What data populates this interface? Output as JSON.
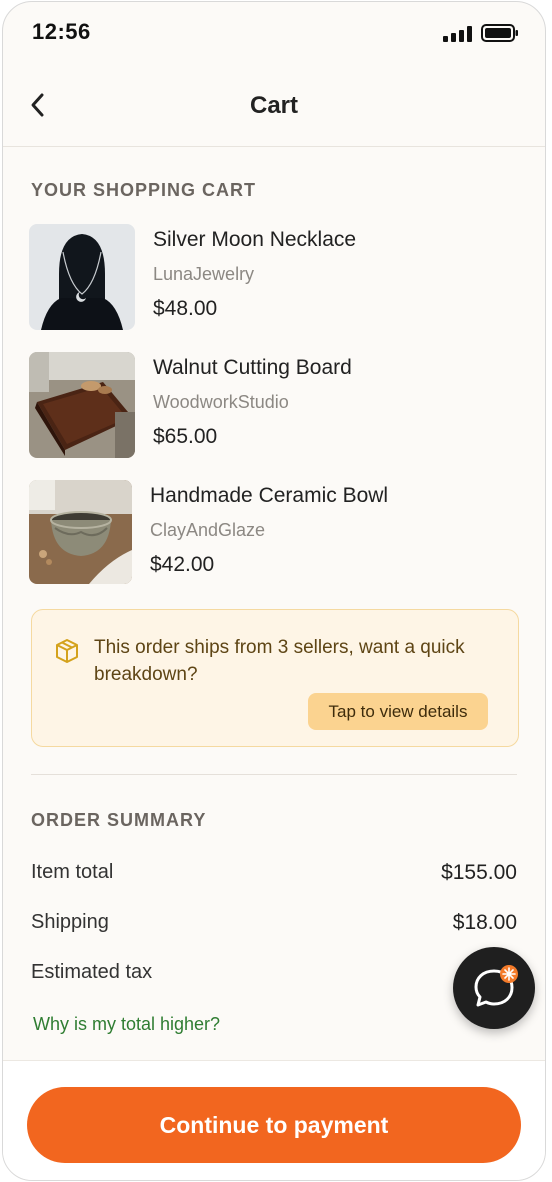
{
  "status_bar": {
    "time": "12:56"
  },
  "header": {
    "title": "Cart"
  },
  "cart": {
    "heading": "YOUR SHOPPING CART",
    "items": [
      {
        "name": "Silver Moon Necklace",
        "seller": "LunaJewelry",
        "price": "$48.00"
      },
      {
        "name": "Walnut Cutting Board",
        "seller": "WoodworkStudio",
        "price": "$65.00"
      },
      {
        "name": "Handmade Ceramic Bowl",
        "seller": "ClayAndGlaze",
        "price": "$42.00"
      }
    ]
  },
  "notice": {
    "text": "This order ships from 3 sellers, want a quick breakdown?",
    "button_label": "Tap to view details"
  },
  "summary": {
    "heading": "ORDER SUMMARY",
    "rows": [
      {
        "label": "Item total",
        "value": "$155.00"
      },
      {
        "label": "Shipping",
        "value": "$18.00"
      },
      {
        "label": "Estimated tax",
        "value": "$"
      }
    ],
    "link": "Why is my total higher?"
  },
  "cta": {
    "label": "Continue to payment"
  },
  "colors": {
    "accent": "#f2661f",
    "link": "#2f7d32",
    "notice_bg": "#fef5e6"
  },
  "icons": [
    "back-chevron-icon",
    "signal-icon",
    "battery-icon",
    "package-icon",
    "chat-icon",
    "sparkle-badge-icon"
  ]
}
